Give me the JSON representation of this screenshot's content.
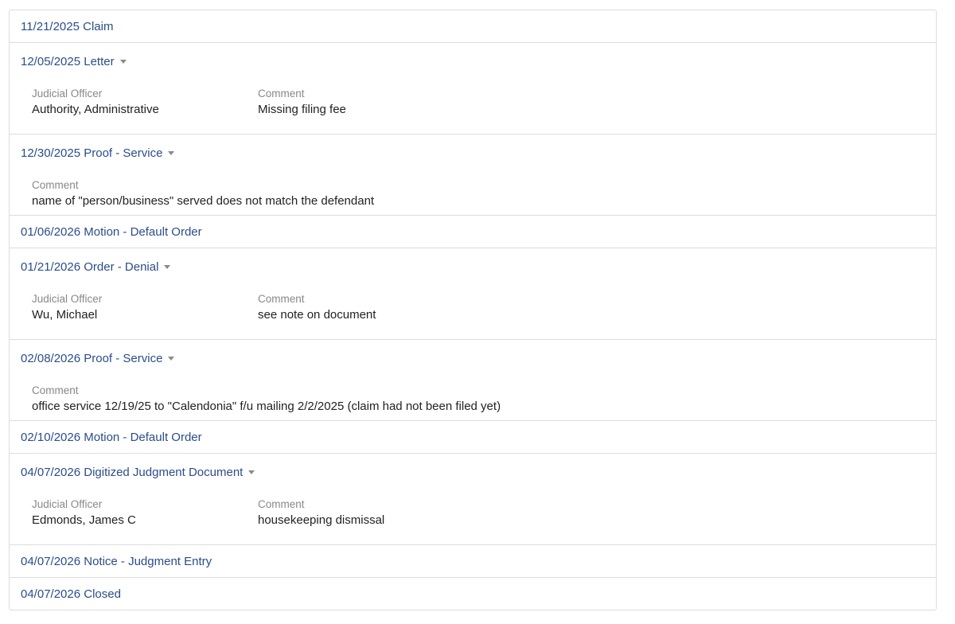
{
  "entries": [
    {
      "title": "11/21/2025 Claim"
    },
    {
      "title": "12/05/2025 Letter",
      "officer_label": "Judicial Officer",
      "officer": "Authority, Administrative",
      "comment_label": "Comment",
      "comment": "Missing filing fee"
    },
    {
      "title": "12/30/2025 Proof - Service",
      "comment_label": "Comment",
      "comment": "name of \"person/business\" served does not match the defendant"
    },
    {
      "title": "01/06/2026 Motion - Default Order"
    },
    {
      "title": "01/21/2026 Order - Denial",
      "officer_label": "Judicial Officer",
      "officer": "Wu, Michael",
      "comment_label": "Comment",
      "comment": "see note on document"
    },
    {
      "title": "02/08/2026 Proof - Service",
      "comment_label": "Comment",
      "comment": "office service 12/19/25 to \"Calendonia\" f/u mailing 2/2/2025 (claim had not been filed yet)"
    },
    {
      "title": "02/10/2026 Motion - Default Order"
    },
    {
      "title": "04/07/2026 Digitized Judgment Document",
      "officer_label": "Judicial Officer",
      "officer": "Edmonds, James C",
      "comment_label": "Comment",
      "comment": "housekeeping dismissal"
    },
    {
      "title": "04/07/2026 Notice - Judgment Entry"
    },
    {
      "title": "04/07/2026 Closed"
    }
  ]
}
